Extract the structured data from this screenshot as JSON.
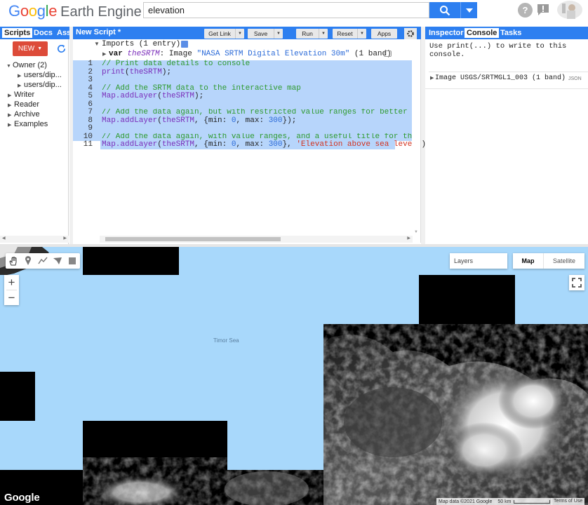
{
  "header": {
    "logo_google": "Google",
    "logo_product": "Earth Engine",
    "search_value": "elevation"
  },
  "left_panel": {
    "tabs": [
      "Scripts",
      "Docs",
      "Ass"
    ],
    "new_label": "NEW",
    "tree": [
      {
        "label": "Owner (2)",
        "expanded": true
      },
      {
        "label": "users/dip...",
        "child": true
      },
      {
        "label": "users/dip...",
        "child": true
      },
      {
        "label": "Writer"
      },
      {
        "label": "Reader"
      },
      {
        "label": "Archive"
      },
      {
        "label": "Examples"
      }
    ]
  },
  "editor": {
    "title": "New Script *",
    "buttons": [
      "Get Link",
      "Save",
      "Run",
      "Reset",
      "Apps"
    ],
    "imports_label": "Imports (1 entry)",
    "import_line": {
      "kw": "var",
      "name": "theSRTM",
      "type": ": Image",
      "desc": "\"NASA SRTM Digital Elevation 30m\"",
      "bands": "(1 band)"
    },
    "line_numbers": [
      "1",
      "2",
      "3",
      "4",
      "5",
      "6",
      "7",
      "8",
      "9",
      "10",
      "11"
    ],
    "lines": {
      "l1": "// Print data details to console",
      "l2_fn": "print",
      "l2_arg": "theSRTM",
      "l4": "// Add the SRTM data to the interactive map",
      "l5_fn": "Map.addLayer",
      "l5_arg": "theSRTM",
      "l7": "// Add the data again, but with restricted value ranges for better visualis",
      "l8_fn": "Map.addLayer",
      "l8_arg": "theSRTM",
      "l8_min": "0",
      "l8_max": "300",
      "l10": "// Add the data again, with value ranges, and a useful title for the Layer",
      "l11_fn": "Map.addLayer",
      "l11_arg": "theSRTM",
      "l11_min": "0",
      "l11_max": "300",
      "l11_str": "'Elevation above sea level'"
    }
  },
  "right_panel": {
    "tabs": [
      "Inspector",
      "Console",
      "Tasks"
    ],
    "console_hint": "Use print(...) to write to this console.",
    "output_label": "Image USGS/SRTMGL1_003 (1 band)",
    "json_label": "JSON"
  },
  "map": {
    "layers_label": "Layers",
    "map_label": "Map",
    "satellite_label": "Satellite",
    "sea_label": "Timor Sea",
    "watermark": "Google",
    "attribution": "Map data ©2021 Google",
    "scale": "50 km",
    "terms": "Terms of Use",
    "colors": {
      "sea": "#a8d8fb",
      "land": "#000000"
    }
  }
}
